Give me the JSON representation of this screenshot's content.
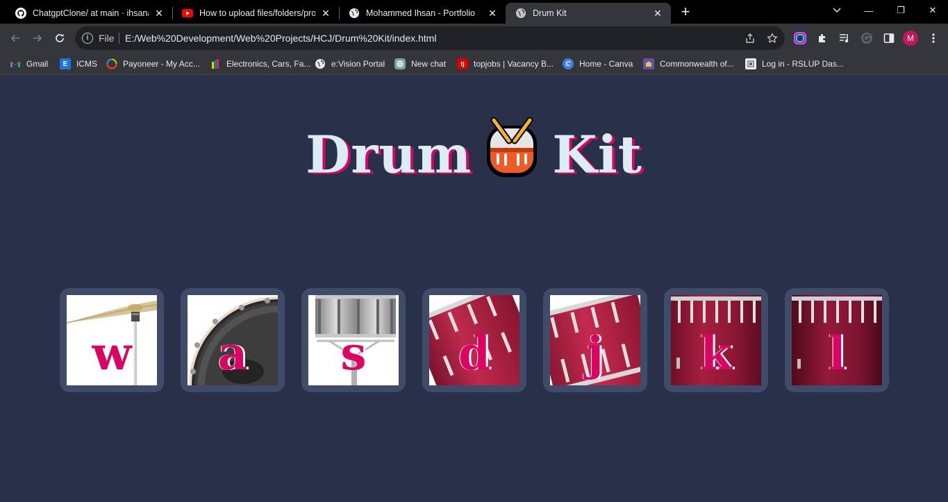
{
  "browser": {
    "tabs": [
      {
        "title": "ChatgptClone/ at main · ihsanakmal",
        "favicon": "github-icon"
      },
      {
        "title": "How to upload files/folders/projects",
        "favicon": "youtube-icon"
      },
      {
        "title": "Mohammed Ihsan - Portfolio",
        "favicon": "globe-icon"
      },
      {
        "title": "Drum Kit",
        "favicon": "globe-icon",
        "active": true
      }
    ],
    "close_glyph": "✕",
    "new_tab_glyph": "+",
    "window_controls": {
      "minimize": "—",
      "restore": "❐",
      "close": "✕"
    }
  },
  "address_bar": {
    "scheme_label": "File",
    "url": "E:/Web%20Development/Web%20Projects/HCJ/Drum%20Kit/index.html"
  },
  "profile": {
    "initial": "M",
    "color": "#c2185b"
  },
  "bookmarks": [
    {
      "label": "Gmail",
      "icon": "gmail-icon"
    },
    {
      "label": "ICMS",
      "icon": "icms-icon"
    },
    {
      "label": "Payoneer - My Acc...",
      "icon": "payoneer-icon"
    },
    {
      "label": "Electronics, Cars, Fa...",
      "icon": "ikman-icon"
    },
    {
      "label": "e:Vision Portal",
      "icon": "globe-icon"
    },
    {
      "label": "New chat",
      "icon": "chatgpt-icon"
    },
    {
      "label": "topjobs | Vacancy B...",
      "icon": "topjobs-icon"
    },
    {
      "label": "Home - Canva",
      "icon": "canva-icon"
    },
    {
      "label": "Commonwealth of...",
      "icon": "commonwealth-icon"
    },
    {
      "label": "Log in - RSLUP Das...",
      "icon": "rslup-icon"
    }
  ],
  "page": {
    "title_left": "Drum",
    "title_right": "Kit",
    "colors": {
      "background": "#283149",
      "pad": "#404b69",
      "accent": "#da0463",
      "title": "#dbedf3"
    },
    "drums": [
      {
        "key": "w",
        "image": "crash-cymbal"
      },
      {
        "key": "a",
        "image": "kick-drum"
      },
      {
        "key": "s",
        "image": "snare-drum"
      },
      {
        "key": "d",
        "image": "tom-1"
      },
      {
        "key": "j",
        "image": "tom-2"
      },
      {
        "key": "k",
        "image": "tom-3"
      },
      {
        "key": "l",
        "image": "tom-4"
      }
    ]
  }
}
